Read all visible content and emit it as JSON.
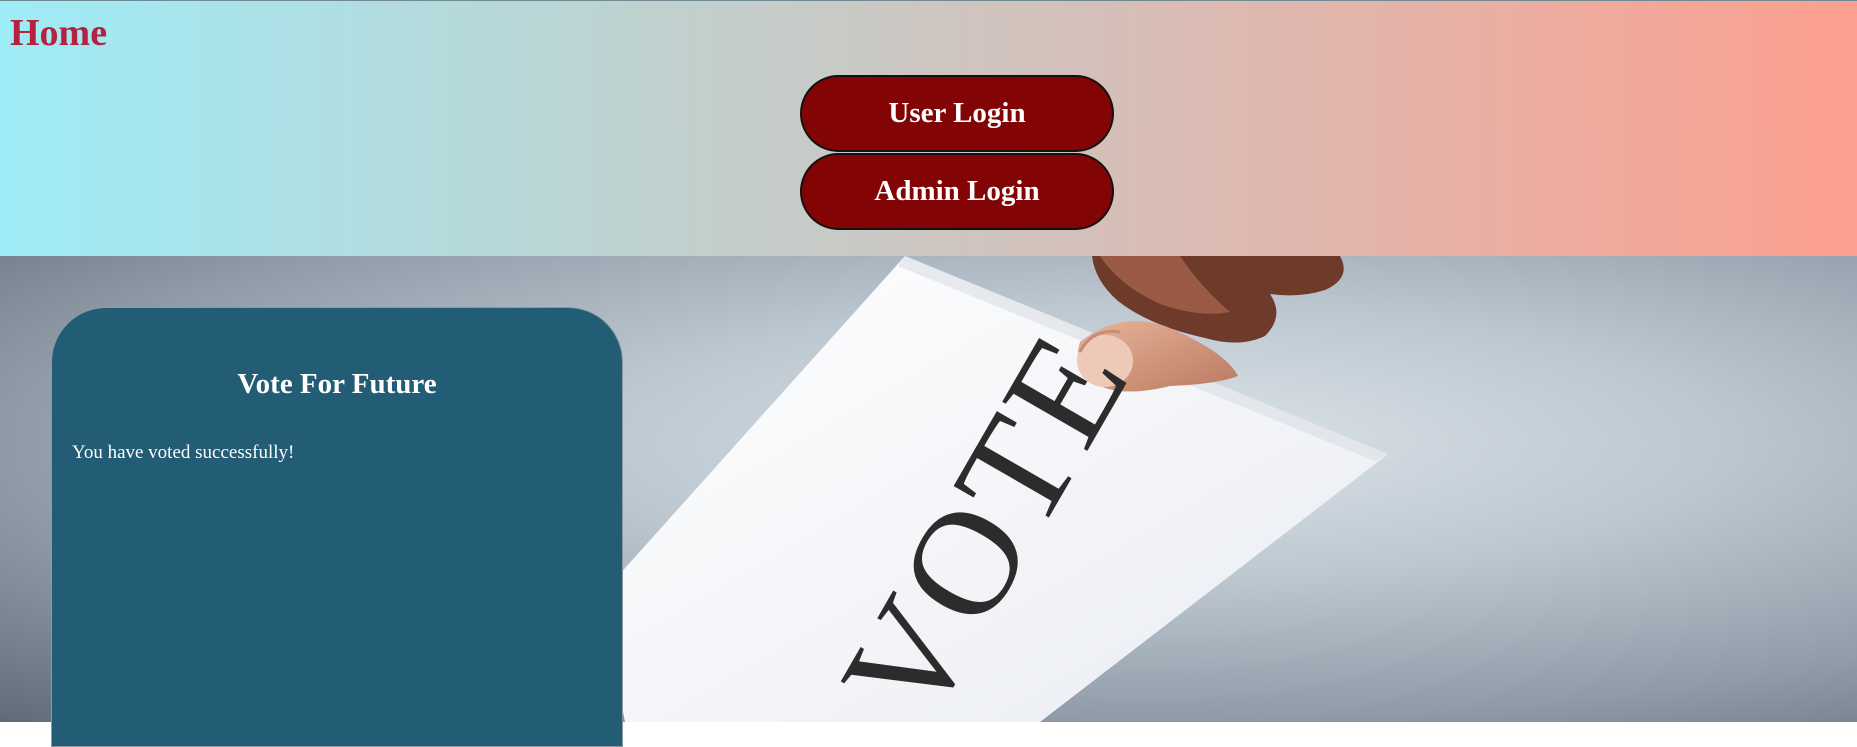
{
  "header": {
    "title": "Home",
    "buttons": {
      "user_login": "User Login",
      "admin_login": "Admin Login"
    }
  },
  "hero": {
    "ballot_text": "VOTE"
  },
  "card": {
    "title": "Vote For Future",
    "message": "You have voted successfully!"
  },
  "colors": {
    "title_color": "#b3223f",
    "button_bg": "#820404",
    "card_bg": "#235c75",
    "header_gradient_left": "#9eecf7",
    "header_gradient_right": "#fc9f8e"
  }
}
